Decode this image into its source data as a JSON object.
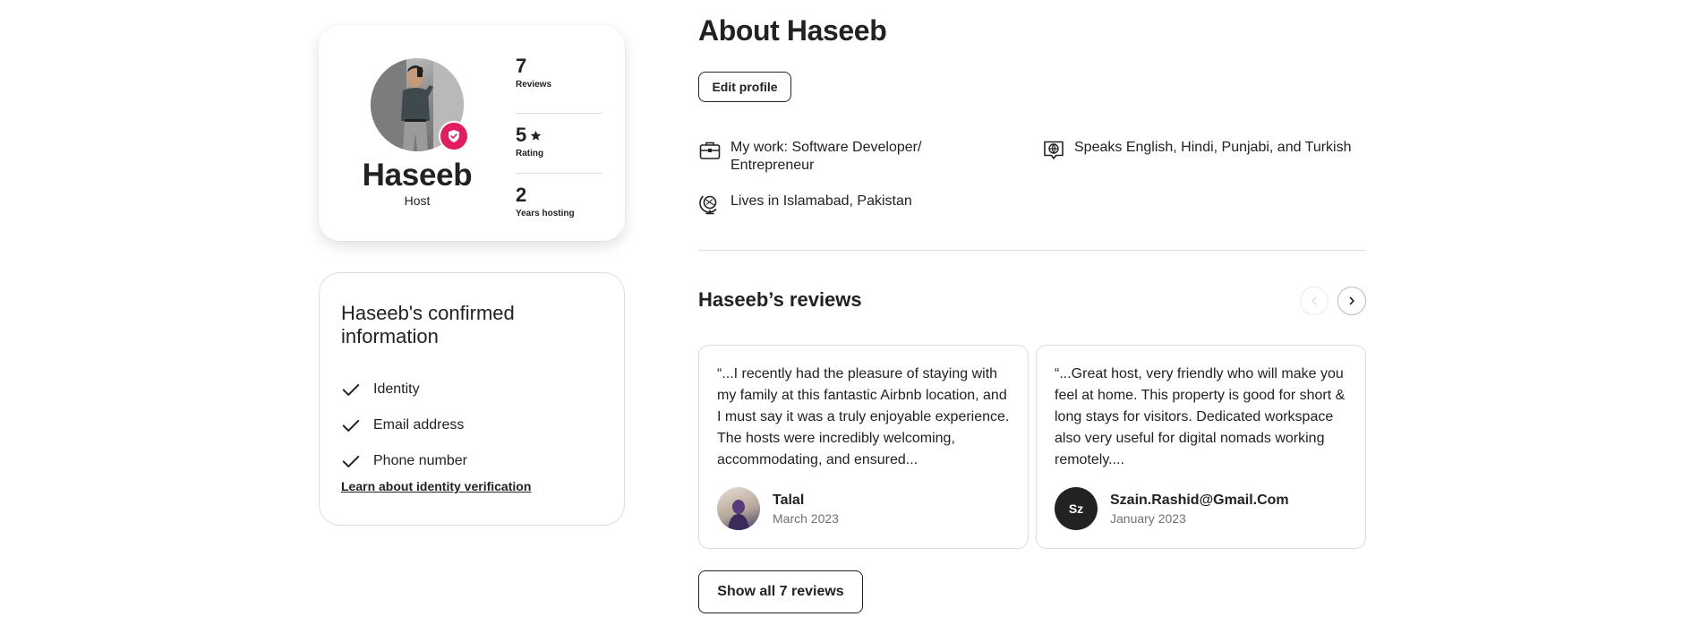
{
  "profile": {
    "name": "Haseeb",
    "role": "Host",
    "stats": [
      {
        "value": "7",
        "label": "Reviews",
        "has_star": false
      },
      {
        "value": "5",
        "label": "Rating",
        "has_star": true
      },
      {
        "value": "2",
        "label": "Years hosting",
        "has_star": false
      }
    ]
  },
  "confirmed": {
    "title": "Haseeb's confirmed information",
    "items": [
      "Identity",
      "Email address",
      "Phone number"
    ],
    "link": "Learn about identity verification"
  },
  "about": {
    "title": "About Haseeb",
    "edit_label": "Edit profile",
    "work": "My work: Software Developer/ Entrepreneur",
    "languages": "Speaks English, Hindi, Punjabi, and Turkish",
    "lives": "Lives in Islamabad, Pakistan"
  },
  "reviews": {
    "title": "Haseeb’s reviews",
    "items": [
      {
        "text": "“...I recently had the pleasure of staying with my family at this fantastic Airbnb location, and I must say it was a truly enjoyable experience. The hosts were incredibly welcoming, accommodating, and ensured...",
        "name": "Talal",
        "date": "March 2023",
        "initials": ""
      },
      {
        "text": "“...Great host, very friendly who will make you feel at home. This property is good for short & long stays for visitors. Dedicated workspace also very useful for digital nomads working remotely....",
        "name": "Szain.Rashid@Gmail.Com",
        "date": "January 2023",
        "initials": "Sz"
      }
    ],
    "show_all_label": "Show all 7 reviews"
  },
  "colors": {
    "badge": "#e31c5f",
    "text": "#222222",
    "muted": "#717171",
    "border": "#dddddd"
  }
}
